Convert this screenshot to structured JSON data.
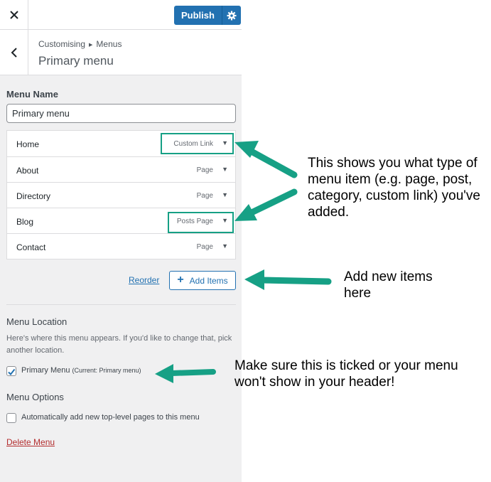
{
  "header": {
    "close_icon": "close-icon",
    "publish_label": "Publish",
    "settings_icon": "gear-icon"
  },
  "breadcrumb": {
    "back_icon": "chevron-left-icon",
    "parent": "Customising",
    "child": "Menus",
    "title": "Primary menu"
  },
  "menu_name": {
    "label": "Menu Name",
    "value": "Primary menu"
  },
  "menu_items": [
    {
      "title": "Home",
      "type": "Custom Link"
    },
    {
      "title": "About",
      "type": "Page"
    },
    {
      "title": "Directory",
      "type": "Page"
    },
    {
      "title": "Blog",
      "type": "Posts Page"
    },
    {
      "title": "Contact",
      "type": "Page"
    }
  ],
  "actions": {
    "reorder_label": "Reorder",
    "add_items_label": "Add Items"
  },
  "menu_location": {
    "title": "Menu Location",
    "description": "Here's where this menu appears. If you'd like to change that, pick another location.",
    "primary_label": "Primary Menu",
    "primary_current": "(Current: Primary menu)",
    "primary_checked": true
  },
  "menu_options": {
    "title": "Menu Options",
    "auto_add_label": "Automatically add new top-level pages to this menu",
    "auto_add_checked": false
  },
  "delete_label": "Delete Menu",
  "annotations": {
    "type_note": "This shows you what type of menu item (e.g. page, post, category, custom link) you've added.",
    "add_note": "Add new items here",
    "tick_note": "Make sure this is ticked or your menu won't show in your header!",
    "arrow_color": "#16a085"
  },
  "colors": {
    "accent": "#2271b1",
    "delete": "#b32d2e",
    "panel_bg": "#f0f0f1",
    "highlight": "#16a085"
  }
}
